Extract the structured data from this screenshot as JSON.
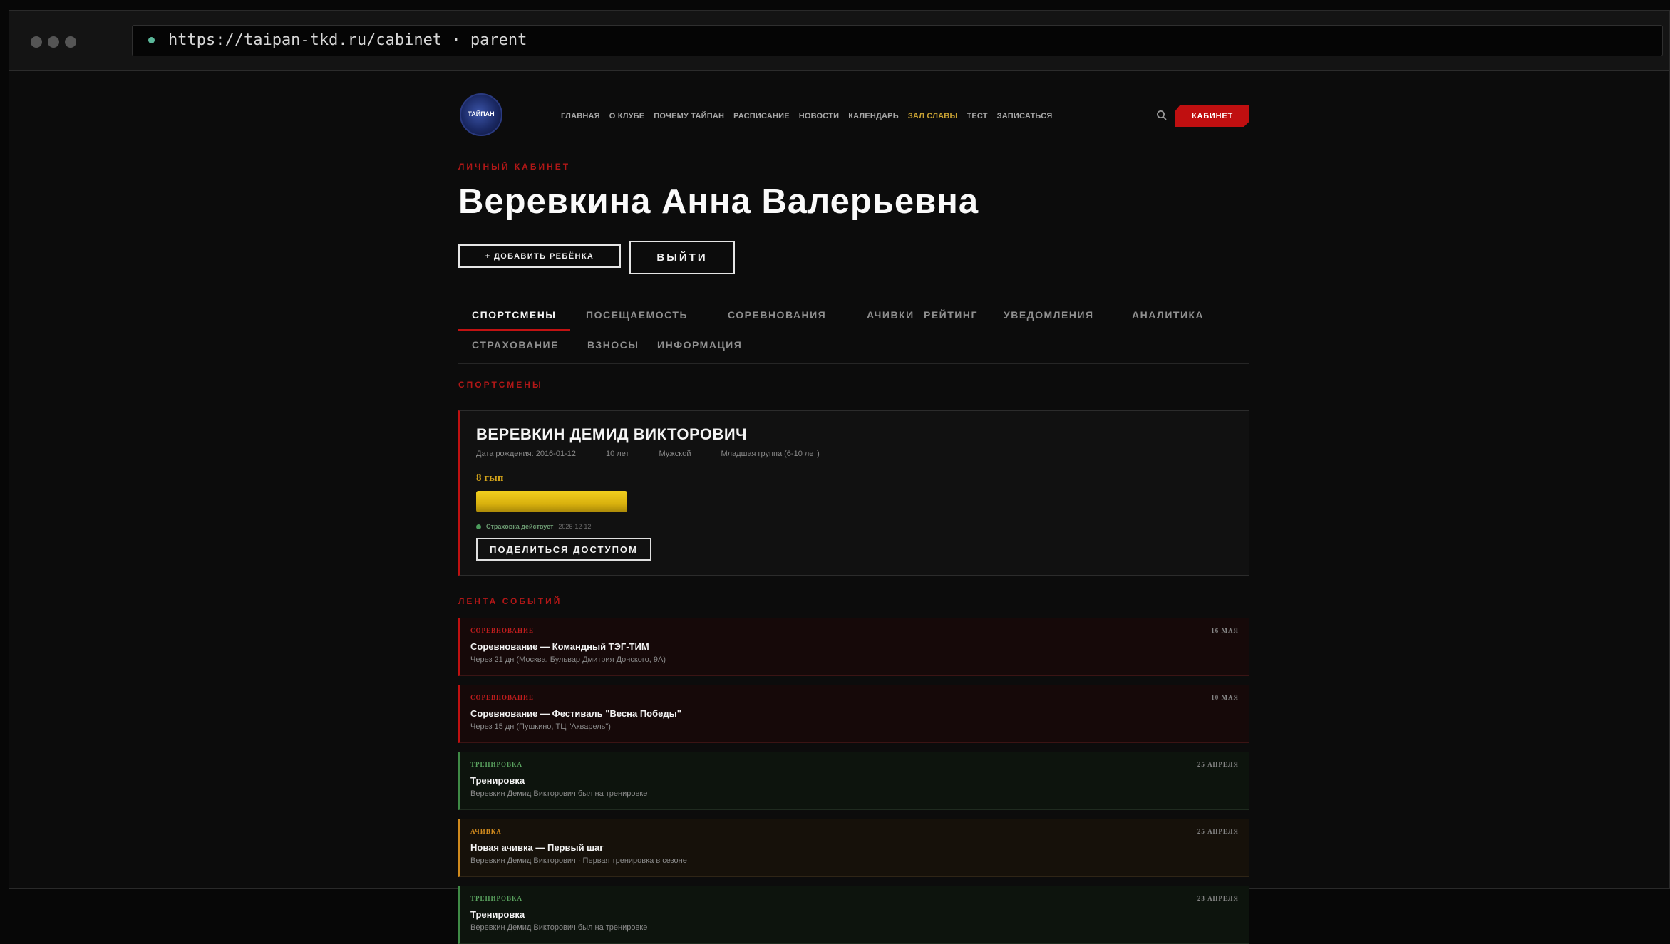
{
  "browser": {
    "url": "https://taipan-tkd.ru/cabinet · parent"
  },
  "header": {
    "logo_text": "ТАЙПАН",
    "nav": [
      "ГЛАВНАЯ",
      "О КЛУБЕ",
      "ПОЧЕМУ ТАЙПАН",
      "РАСПИСАНИЕ",
      "НОВОСТИ",
      "КАЛЕНДАРЬ",
      "ЗАЛ СЛАВЫ",
      "ТЕСТ",
      "ЗАПИСАТЬСЯ"
    ],
    "highlight_nav_item": "ЗАЛ СЛАВЫ",
    "cabinet_button": "КАБИНЕТ"
  },
  "profile": {
    "eyebrow": "ЛИЧНЫЙ КАБИНЕТ",
    "name": "Веревкина Анна Валерьевна",
    "add_child_button": "+ ДОБАВИТЬ РЕБЁНКА",
    "logout_button": "ВЫЙТИ"
  },
  "tabs": [
    "СПОРТСМЕНЫ",
    "ПОСЕЩАЕМОСТЬ",
    "СОРЕВНОВАНИЯ",
    "АЧИВКИ",
    "РЕЙТИНГ",
    "УВЕДОМЛЕНИЯ",
    "АНАЛИТИКА",
    "СТРАХОВАНИЕ",
    "ВЗНОСЫ",
    "ИНФОРМАЦИЯ"
  ],
  "active_tab": "СПОРТСМЕНЫ",
  "athletes_section": {
    "title": "СПОРТСМЕНЫ",
    "athlete": {
      "name": "ВЕРЕВКИН ДЕМИД ВИКТОРОВИЧ",
      "birth_date": "Дата рождения: 2016-01-12",
      "age": "10 лет",
      "gender": "Мужской",
      "group": "Младшая группа (6-10 лет)",
      "belt": "8 гып",
      "belt_color": "#e6c014",
      "insurance_status": "Страховка действует",
      "insurance_date": "2026-12-12",
      "share_button": "ПОДЕЛИТЬСЯ ДОСТУПОМ"
    }
  },
  "feed": {
    "title": "ЛЕНТА СОБЫТИЙ",
    "events": [
      {
        "type": "СОРЕВНОВАНИЕ",
        "title": "Соревнование — Командный ТЭГ-ТИМ",
        "subtitle": "Через 21 дн (Москва, Бульвар Дмитрия Донского, 9А)",
        "date": "16 МАЯ",
        "kind": "red"
      },
      {
        "type": "СОРЕВНОВАНИЕ",
        "title": "Соревнование — Фестиваль \"Весна Победы\"",
        "subtitle": "Через 15 дн (Пушкино, ТЦ \"Акварель\")",
        "date": "10 МАЯ",
        "kind": "red"
      },
      {
        "type": "ТРЕНИРОВКА",
        "title": "Тренировка",
        "subtitle": "Веревкин Демид Викторович был на тренировке",
        "date": "25 АПРЕЛЯ",
        "kind": "green"
      },
      {
        "type": "АЧИВКА",
        "title": "Новая ачивка — Первый шаг",
        "subtitle": "Веревкин Демид Викторович · Первая тренировка в сезоне",
        "date": "25 АПРЕЛЯ",
        "kind": "orange"
      },
      {
        "type": "ТРЕНИРОВКА",
        "title": "Тренировка",
        "subtitle": "Веревкин Демид Викторович был на тренировке",
        "date": "23 АПРЕЛЯ",
        "kind": "green"
      }
    ]
  },
  "colors": {
    "accent_red": "#c01010",
    "gold": "#c9a233",
    "training_green": "#3f8a46",
    "achievement_orange": "#d08a1d"
  }
}
